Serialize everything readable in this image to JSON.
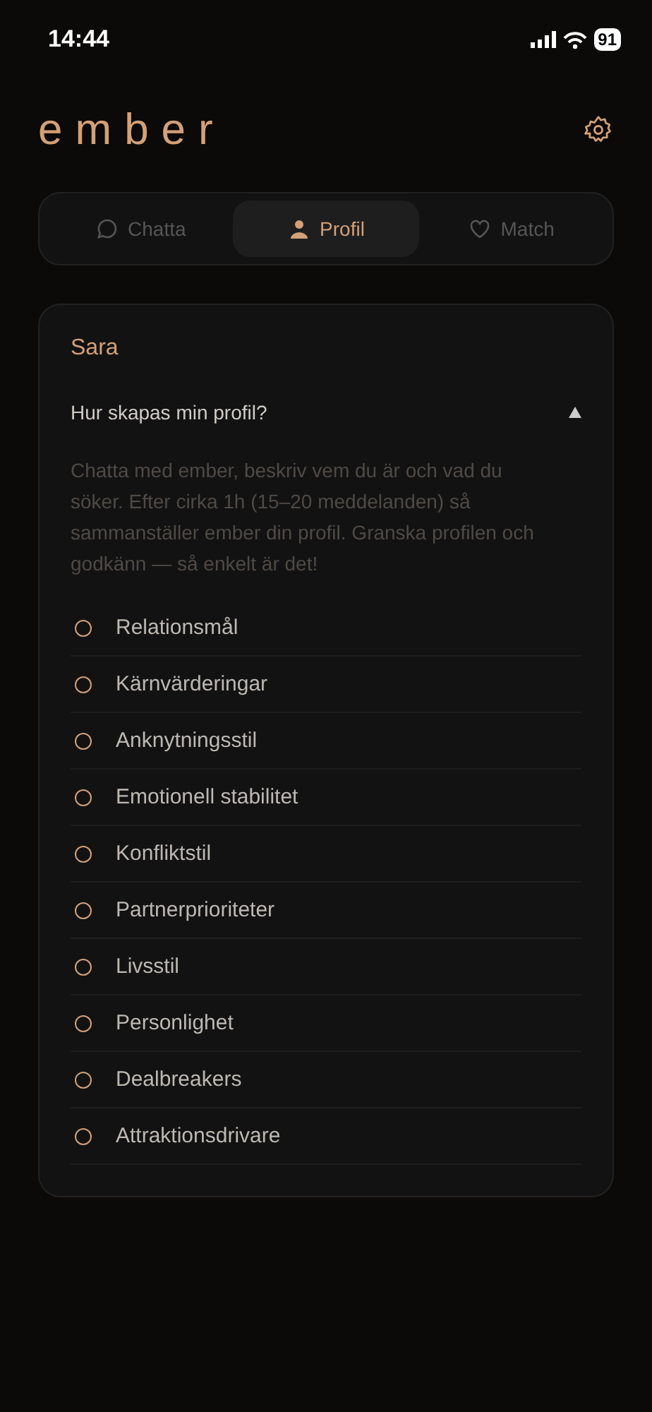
{
  "status_bar": {
    "time": "14:44",
    "battery": "91"
  },
  "header": {
    "logo": "ember"
  },
  "tabs": [
    {
      "label": "Chatta",
      "selected": false
    },
    {
      "label": "Profil",
      "selected": true
    },
    {
      "label": "Match",
      "selected": false
    }
  ],
  "card": {
    "name": "Sara",
    "faq": {
      "question": "Hur skapas min profil?",
      "expanded": true,
      "answer": "Chatta med ember, beskriv vem du är och vad du söker. Efter cirka 1h (15–20 meddelanden) så sammanställer ember din profil. Granska profilen och godkänn — så enkelt är det!"
    },
    "items": [
      {
        "label": "Relationsmål",
        "done": false
      },
      {
        "label": "Kärnvärderingar",
        "done": false
      },
      {
        "label": "Anknytningsstil",
        "done": false
      },
      {
        "label": "Emotionell stabilitet",
        "done": false
      },
      {
        "label": "Konfliktstil",
        "done": false
      },
      {
        "label": "Partnerprioriteter",
        "done": false
      },
      {
        "label": "Livsstil",
        "done": false
      },
      {
        "label": "Personlighet",
        "done": false
      },
      {
        "label": "Dealbreakers",
        "done": false
      },
      {
        "label": "Attraktionsdrivare",
        "done": false
      }
    ]
  }
}
